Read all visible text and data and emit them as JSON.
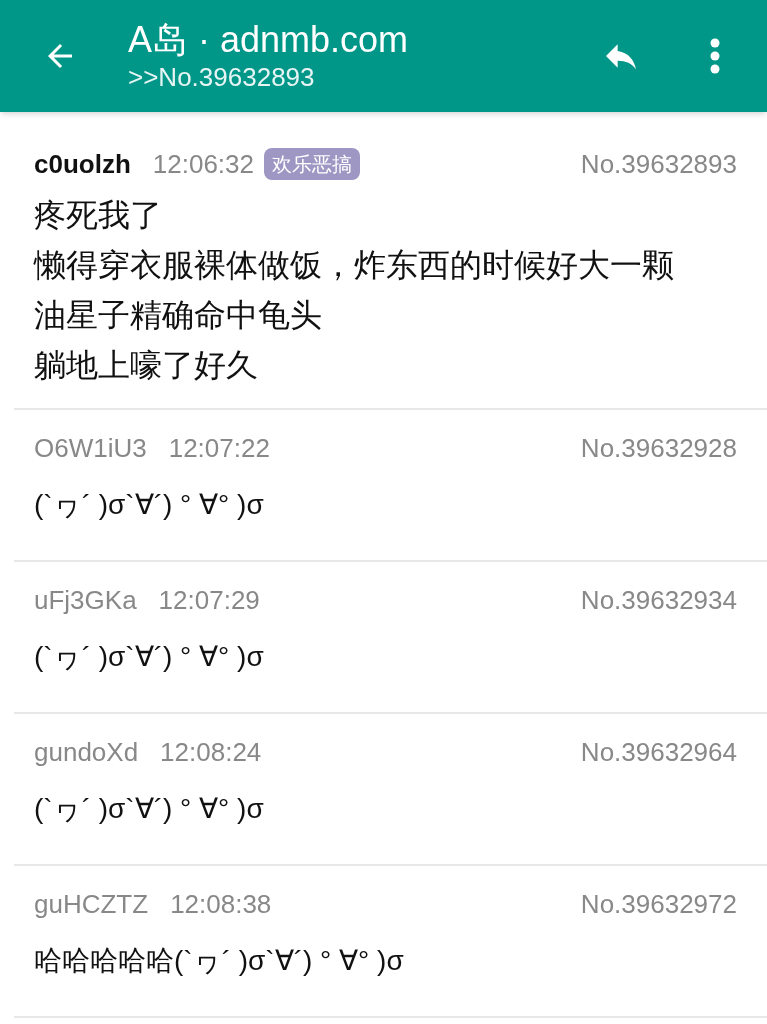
{
  "app_bar": {
    "title": "A岛 · adnmb.com",
    "subtitle": ">>No.39632893"
  },
  "posts": [
    {
      "author": "c0uolzh",
      "op": true,
      "time": "12:06:32",
      "tag": "欢乐恶搞",
      "number": "No.39632893",
      "lines": [
        "疼死我了",
        "懒得穿衣服裸体做饭，炸东西的时候好大一颗油星子精确命中龟头",
        "躺地上嚎了好久"
      ]
    },
    {
      "author": "O6W1iU3",
      "op": false,
      "time": "12:07:22",
      "number": "No.39632928",
      "lines": [
        "(`ヮ´ )σ`∀´) ° ∀° )σ"
      ]
    },
    {
      "author": "uFj3GKa",
      "op": false,
      "time": "12:07:29",
      "number": "No.39632934",
      "lines": [
        "(`ヮ´ )σ`∀´) ° ∀° )σ"
      ]
    },
    {
      "author": "gundoXd",
      "op": false,
      "time": "12:08:24",
      "number": "No.39632964",
      "lines": [
        "(`ヮ´ )σ`∀´) ° ∀° )σ"
      ]
    },
    {
      "author": "guHCZTZ",
      "op": false,
      "time": "12:08:38",
      "number": "No.39632972",
      "lines": [
        "哈哈哈哈哈(`ヮ´ )σ`∀´) ° ∀° )σ"
      ]
    }
  ]
}
